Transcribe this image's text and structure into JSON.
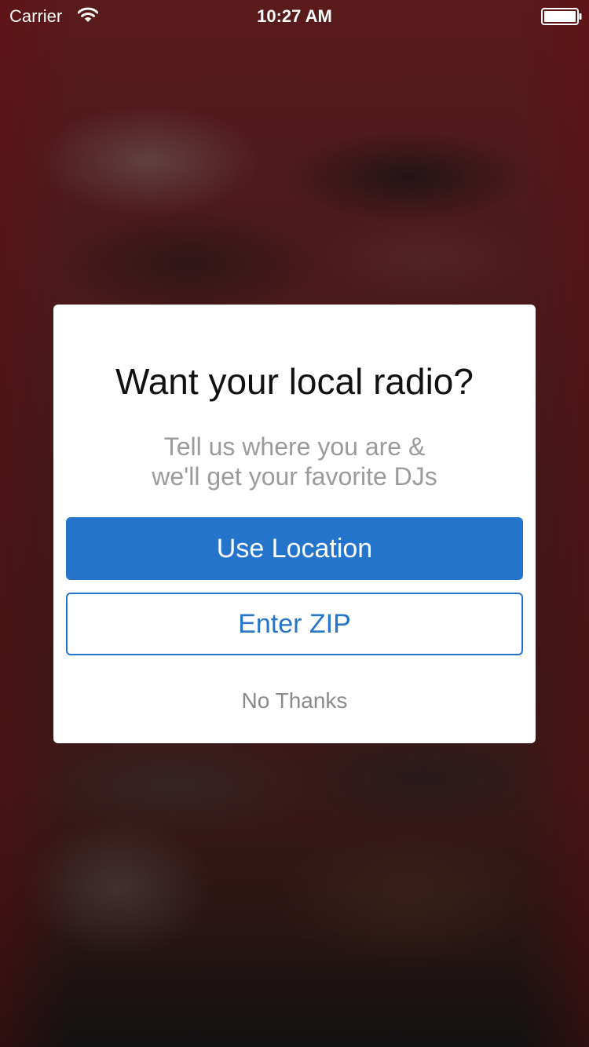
{
  "status_bar": {
    "carrier": "Carrier",
    "time": "10:27 AM",
    "icons": [
      "wifi-icon",
      "battery-icon"
    ]
  },
  "modal": {
    "title": "Want your local radio?",
    "subtitle_line1": "Tell us where you are &",
    "subtitle_line2": "we'll get your favorite DJs",
    "primary_button": "Use Location",
    "secondary_button": "Enter ZIP",
    "dismiss_button": "No Thanks"
  },
  "colors": {
    "accent": "#2474cb",
    "subtitle_text": "#9b9b9b",
    "dismiss_text": "#8a8a8a",
    "backdrop": "#3f1919"
  }
}
